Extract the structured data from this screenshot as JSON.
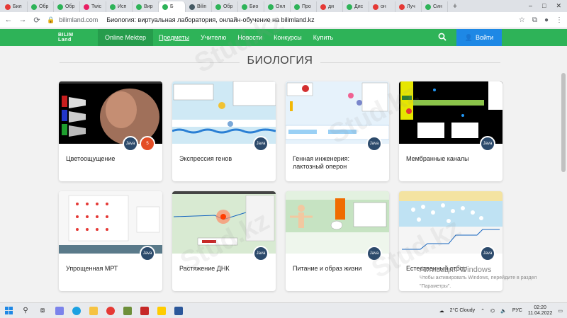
{
  "browser": {
    "tabs": [
      {
        "label": "Бил",
        "color": "#e53935"
      },
      {
        "label": "Обр",
        "color": "#2eb358"
      },
      {
        "label": "Обр",
        "color": "#2eb358"
      },
      {
        "label": "Twic",
        "color": "#e91e63"
      },
      {
        "label": "Исп",
        "color": "#2eb358"
      },
      {
        "label": "Вир",
        "color": "#2eb358"
      },
      {
        "label": "Б",
        "color": "#2eb358",
        "active": true
      },
      {
        "label": "Bilin",
        "color": "#455a64"
      },
      {
        "label": "Обр",
        "color": "#2eb358"
      },
      {
        "label": "Био",
        "color": "#2eb358"
      },
      {
        "label": "Онл",
        "color": "#2eb358"
      },
      {
        "label": "Про",
        "color": "#2eb358"
      },
      {
        "label": "ди",
        "color": "#e53935"
      },
      {
        "label": "Дис",
        "color": "#2eb358"
      },
      {
        "label": "он",
        "color": "#e53935"
      },
      {
        "label": "Луч",
        "color": "#e53935"
      },
      {
        "label": "Син",
        "color": "#2eb358"
      }
    ],
    "new_tab": "+",
    "window_controls": [
      "–",
      "□",
      "✕"
    ],
    "url_domain": "bilimland.com",
    "page_title": "Биология: виртуальная лаборатория, онлайн-обучение на bilimland.kz"
  },
  "site": {
    "logo_line1": "BILIM",
    "logo_line2": "Land",
    "nav": [
      "Online Mektep",
      "Предметы",
      "Учителю",
      "Новости",
      "Конкурсы",
      "Купить"
    ],
    "login": "Войти",
    "section_title": "БИОЛОГИЯ",
    "cards": [
      {
        "title": "Цветоощущение",
        "badge": "java"
      },
      {
        "title": "Экспрессия генов",
        "badge": "java"
      },
      {
        "title": "Генная инженерия: лактозный оперон",
        "badge": "java"
      },
      {
        "title": "Мембранные каналы",
        "badge": "java"
      },
      {
        "title": "Упрощенная МРТ",
        "badge": "java"
      },
      {
        "title": "Растяжение ДНК",
        "badge": "java"
      },
      {
        "title": "Питание и образ жизни",
        "badge": "java"
      },
      {
        "title": "Естественный отбор",
        "badge": "java"
      }
    ],
    "html5_badge": "5",
    "java_label": "Java"
  },
  "overlay": {
    "activation_title": "Активация Windows",
    "activation_text": "Чтобы активировать Windows, перейдите в раздел \"Параметры\".",
    "watermark": "Stud.kz"
  },
  "taskbar": {
    "weather": "2°C Cloudy",
    "lang": "РУС",
    "time": "02:20",
    "date": "11.04.2022"
  }
}
